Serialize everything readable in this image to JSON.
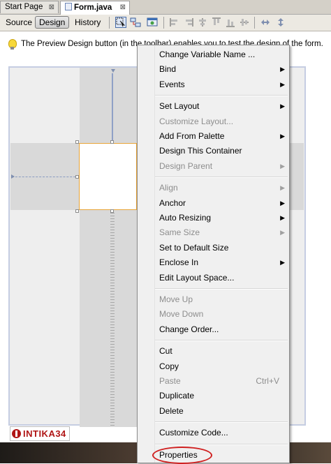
{
  "tabs": [
    {
      "label": "Start Page",
      "active": false
    },
    {
      "label": "Form.java",
      "active": true
    }
  ],
  "tab_close_glyph": "⊠",
  "toolbar": {
    "source_label": "Source",
    "design_label": "Design",
    "history_label": "History",
    "selected_view": "Design"
  },
  "hint": {
    "text": "The Preview Design button (in the toolbar) enables you to test the design of the form."
  },
  "watermark": "INTIKA34",
  "context_menu": {
    "items": [
      {
        "label": "Change Variable Name ...",
        "enabled": true,
        "submenu": false
      },
      {
        "label": "Bind",
        "enabled": true,
        "submenu": true
      },
      {
        "label": "Events",
        "enabled": true,
        "submenu": true
      },
      {
        "separator": true
      },
      {
        "label": "Set Layout",
        "enabled": true,
        "submenu": true
      },
      {
        "label": "Customize Layout...",
        "enabled": false,
        "submenu": false
      },
      {
        "label": "Add From Palette",
        "enabled": true,
        "submenu": true
      },
      {
        "label": "Design This Container",
        "enabled": true,
        "submenu": false
      },
      {
        "label": "Design Parent",
        "enabled": false,
        "submenu": true
      },
      {
        "separator": true
      },
      {
        "label": "Align",
        "enabled": false,
        "submenu": true
      },
      {
        "label": "Anchor",
        "enabled": true,
        "submenu": true
      },
      {
        "label": "Auto Resizing",
        "enabled": true,
        "submenu": true
      },
      {
        "label": "Same Size",
        "enabled": false,
        "submenu": true
      },
      {
        "label": "Set to Default Size",
        "enabled": true,
        "submenu": false
      },
      {
        "label": "Enclose In",
        "enabled": true,
        "submenu": true
      },
      {
        "label": "Edit Layout Space...",
        "enabled": true,
        "submenu": false
      },
      {
        "separator": true
      },
      {
        "label": "Move Up",
        "enabled": false,
        "submenu": false
      },
      {
        "label": "Move Down",
        "enabled": false,
        "submenu": false
      },
      {
        "label": "Change Order...",
        "enabled": true,
        "submenu": false
      },
      {
        "separator": true
      },
      {
        "label": "Cut",
        "enabled": true,
        "submenu": false
      },
      {
        "label": "Copy",
        "enabled": true,
        "submenu": false
      },
      {
        "label": "Paste",
        "enabled": false,
        "submenu": false,
        "shortcut": "Ctrl+V"
      },
      {
        "label": "Duplicate",
        "enabled": true,
        "submenu": false
      },
      {
        "label": "Delete",
        "enabled": true,
        "submenu": false
      },
      {
        "separator": true
      },
      {
        "label": "Customize Code...",
        "enabled": true,
        "submenu": false
      },
      {
        "separator": true
      },
      {
        "label": "Properties",
        "enabled": true,
        "submenu": false,
        "highlighted_by_annotation": true
      }
    ],
    "annotation_color": "#d02020"
  }
}
